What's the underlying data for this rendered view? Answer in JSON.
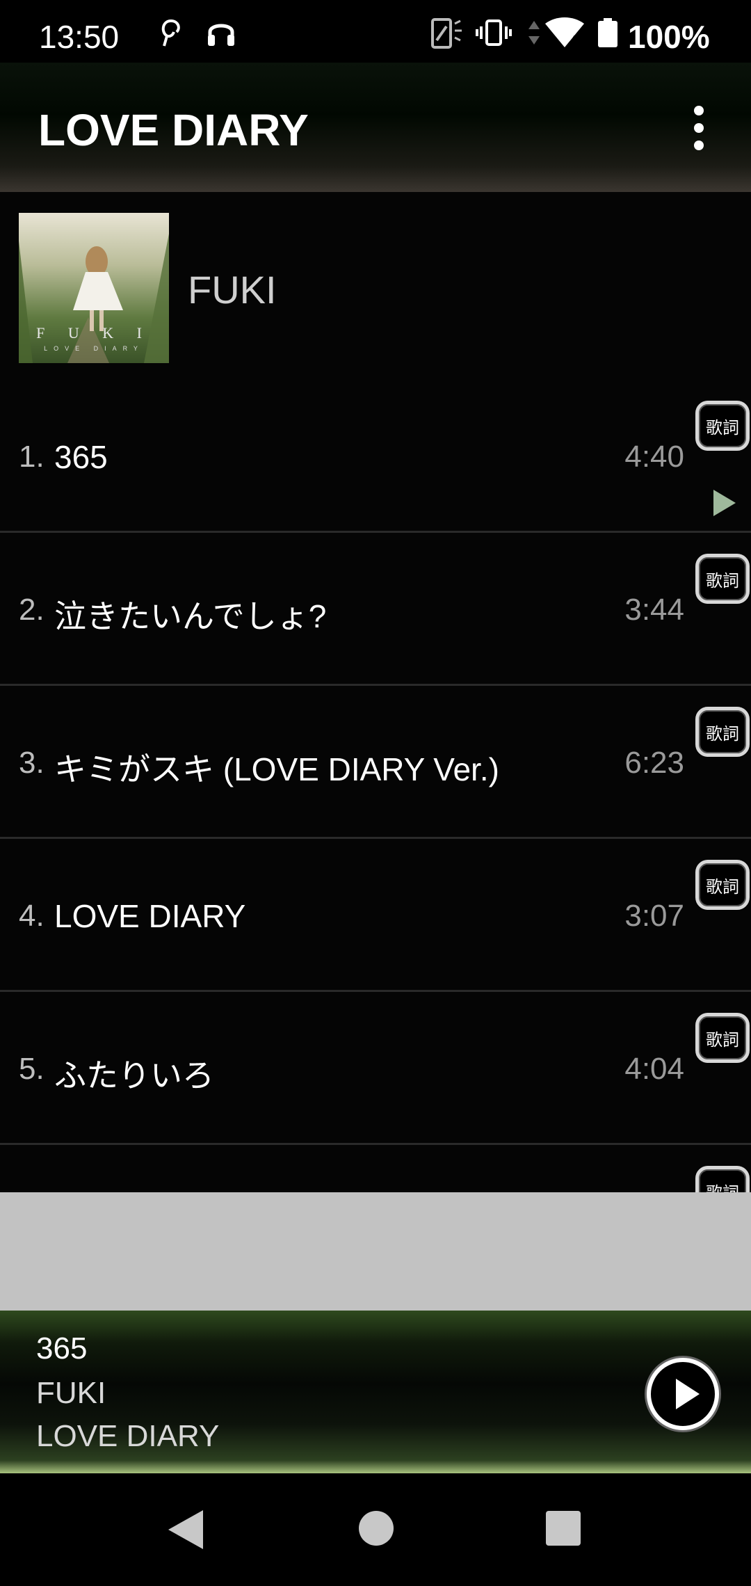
{
  "status_bar": {
    "time": "13:50",
    "battery": "100%",
    "icons": [
      "app-notification-icon",
      "headphones-icon",
      "screen-rotate-icon",
      "vibrate-icon",
      "data-arrows-icon",
      "wifi-icon",
      "battery-icon"
    ]
  },
  "toolbar": {
    "title": "LOVE DIARY",
    "menu_icon": "more-vert-icon"
  },
  "album": {
    "artist": "FUKI",
    "art_text_main": "F U K I",
    "art_text_sub": "LOVE DIARY"
  },
  "tracks": [
    {
      "num": "1.",
      "title": "365",
      "duration": "4:40",
      "lyrics_label": "歌詞",
      "now_playing": true
    },
    {
      "num": "2.",
      "title": "泣きたいんでしょ?",
      "duration": "3:44",
      "lyrics_label": "歌詞"
    },
    {
      "num": "3.",
      "title": "キミがスキ (LOVE DIARY Ver.)",
      "duration": "6:23",
      "lyrics_label": "歌詞"
    },
    {
      "num": "4.",
      "title": "LOVE DIARY",
      "duration": "3:07",
      "lyrics_label": "歌詞"
    },
    {
      "num": "5.",
      "title": "ふたりいろ",
      "duration": "4:04",
      "lyrics_label": "歌詞"
    },
    {
      "lyrics_label": "歌詞"
    }
  ],
  "mini_player": {
    "title": "365",
    "artist": "FUKI",
    "album": "LOVE DIARY",
    "play_icon": "play-circle-icon"
  },
  "colors": {
    "accent_green": "#a9c37e",
    "now_playing_indicator": "#9fb99c",
    "ad_area": "#c2c2c2"
  }
}
